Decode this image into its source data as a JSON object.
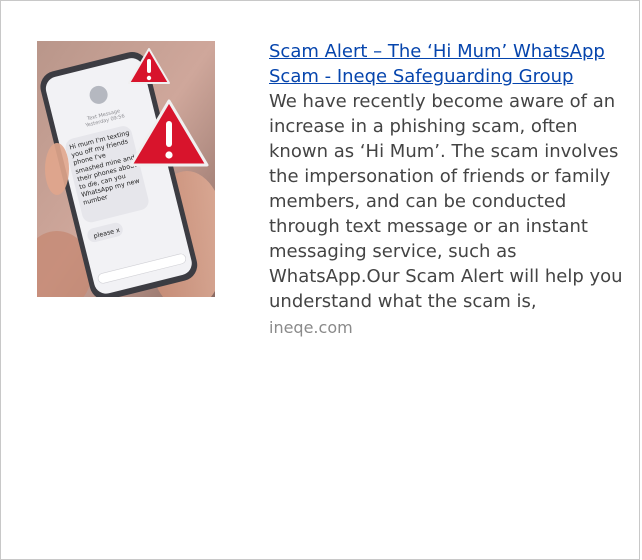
{
  "result": {
    "title": "Scam Alert – The ‘Hi Mum’ WhatsApp Scam - Ineqe Safeguarding Group",
    "description": "We have recently become aware of an increase in a phishing scam, often known as ‘Hi Mum’. The scam involves the impersonation of friends or family members, and can be conducted through text message or an instant messaging service, such as WhatsApp.Our Scam Alert will help you understand what the scam is,",
    "source": "ineqe.com",
    "thumbnail": {
      "icon": "warning-icon",
      "message_header": "Text Message",
      "message_header_time": "Yesterday 09:56",
      "message_body": "Hi mum I'm texting you off my friends phone I've smashed mine and their phones about to die, can you WhatsApp my new number",
      "message_reply": "please x"
    }
  },
  "colors": {
    "link": "#0645ad",
    "text": "#444444",
    "source": "#8a8a8a",
    "warning": "#d8142c",
    "border": "#c8c8c8"
  }
}
